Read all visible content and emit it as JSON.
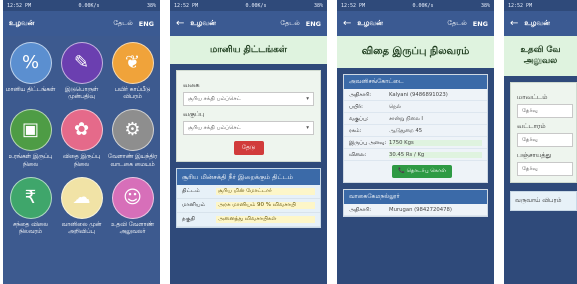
{
  "status": {
    "time": "12:52 PM",
    "net": "0.00K/s",
    "battery": "38%"
  },
  "appbar": {
    "title": "உழவன்",
    "search": "தேடல்",
    "lang": "ENG"
  },
  "home": {
    "tiles": [
      {
        "label": "மானிய திட்டங்கள்",
        "icon": "scheme-icon",
        "bg": "#5b8fd0"
      },
      {
        "label": "இடுபொருள் முன்பதிவு",
        "icon": "note-icon",
        "bg": "#6b3fb0"
      },
      {
        "label": "பயிர் காப்பீடு விபரம்",
        "icon": "plant-hands-icon",
        "bg": "#f0a33a"
      },
      {
        "label": "உரங்கள் இருப்பு நிலை",
        "icon": "fertilizer-icon",
        "bg": "#4e9c45"
      },
      {
        "label": "விதை இருப்பு நிலை",
        "icon": "seed-icon",
        "bg": "#e56a8a"
      },
      {
        "label": "வேளாண் இயந்திர வாடகை மையம்",
        "icon": "tractor-icon",
        "bg": "#8e8e8e"
      },
      {
        "label": "சந்தை விலை நிலவரம்",
        "icon": "money-bag-icon",
        "bg": "#3fa66b"
      },
      {
        "label": "வானிலை முன் அறிவிப்பு",
        "icon": "weather-icon",
        "bg": "#f1e3a6"
      },
      {
        "label": "உதவி வேளாண் அலுவலர்",
        "icon": "officer-icon",
        "bg": "#d76fb9"
      }
    ]
  },
  "screen2": {
    "banner": "மானிய திட்டங்கள்",
    "field1_label": "வகை",
    "field1_value": "சூரிய சக்தி பம்ப்செட்",
    "field2_label": "வகுப்பு",
    "field2_value": "சூரிய சக்தி பம்ப்செட்",
    "search_btn": "தேடு",
    "scheme_title": "சூரிய மின்சக்தி நீர் இறைக்கும் திட்டம்",
    "rows": [
      {
        "k": "திட்டம்",
        "v": "சூரிய மின் மோட்டார்"
      },
      {
        "k": "மானியம்",
        "v": "அரசு மானியம் 90 % விவசாயி"
      },
      {
        "k": "தகுதி",
        "v": "அனைத்து விவசாயிகள்"
      }
    ]
  },
  "screen3": {
    "banner": "விதை இருப்பு நிலவரம்",
    "card_head": "அவனிசங்கோட்டை",
    "rows": [
      {
        "k": "அதிகாரி:",
        "v": "Kalyani (9486891023)"
      },
      {
        "k": "பயிர்:",
        "v": "நெல்"
      },
      {
        "k": "வகுப்பு:",
        "v": "சான்று நிலை I"
      },
      {
        "k": "ரகம்:",
        "v": "ஆடுதுறை 45"
      },
      {
        "k": "இருப்பு அளவு:",
        "v": "1750 Kgs"
      },
      {
        "k": "விலை:",
        "v": "30.45 Rs / Kg"
      }
    ],
    "contact_btn": "📞 தொடர்பு கொள்",
    "card2_head": "வாகைகேமநல்லூர்",
    "card2_row": {
      "k": "அதிகாரி:",
      "v": "Murugan (9842720478)"
    }
  },
  "screen4": {
    "banner_line1": "உதவி வே",
    "banner_line2": "அலுவல",
    "label1": "மாவட்டம்",
    "sel1": "தேர்வு",
    "label2": "வட்டாரம்",
    "sel2": "தேர்வு",
    "label3": "பஞ்சாயத்து",
    "sel3": "தேர்வு",
    "sub": "வருவாய் விபரம்"
  }
}
